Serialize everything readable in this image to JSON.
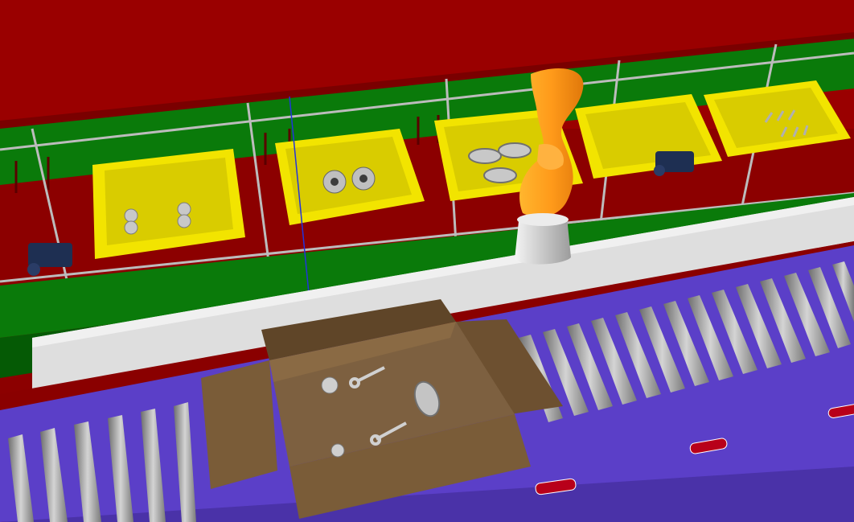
{
  "scene": {
    "description_note": "",
    "colors": {
      "wall": "#9a0000",
      "wall_dark": "#6e0000",
      "shelf_green": "#0a7a0a",
      "shelf_green_dark": "#055a05",
      "bin_yellow": "#f2e400",
      "bin_yellow_dark": "#c9bb00",
      "frame_gray": "#b9b9b9",
      "ledge_white": "#dedede",
      "conveyor_purple": "#5b3fc8",
      "roller_gray": "#9a9a9a",
      "box_brown": "#7a5c38",
      "box_brown_dark": "#5f4528",
      "robot_orange": "#ff9a1a",
      "robot_base": "#d8d8d8",
      "part_metal": "#c8c8c8",
      "camera_blue": "#1e2f52"
    },
    "bins": [
      {
        "id": "bin-1",
        "contents": "gear"
      },
      {
        "id": "bin-2",
        "contents": "bearing"
      },
      {
        "id": "bin-3",
        "contents": "flange"
      },
      {
        "id": "bin-4",
        "contents": "empty"
      },
      {
        "id": "bin-5",
        "contents": "connecting-rod"
      }
    ],
    "box_contents": [
      "gear",
      "connecting-rod",
      "flange",
      "connecting-rod",
      "gear"
    ],
    "icons": [
      "camera-icon",
      "robot-arm-icon"
    ]
  }
}
